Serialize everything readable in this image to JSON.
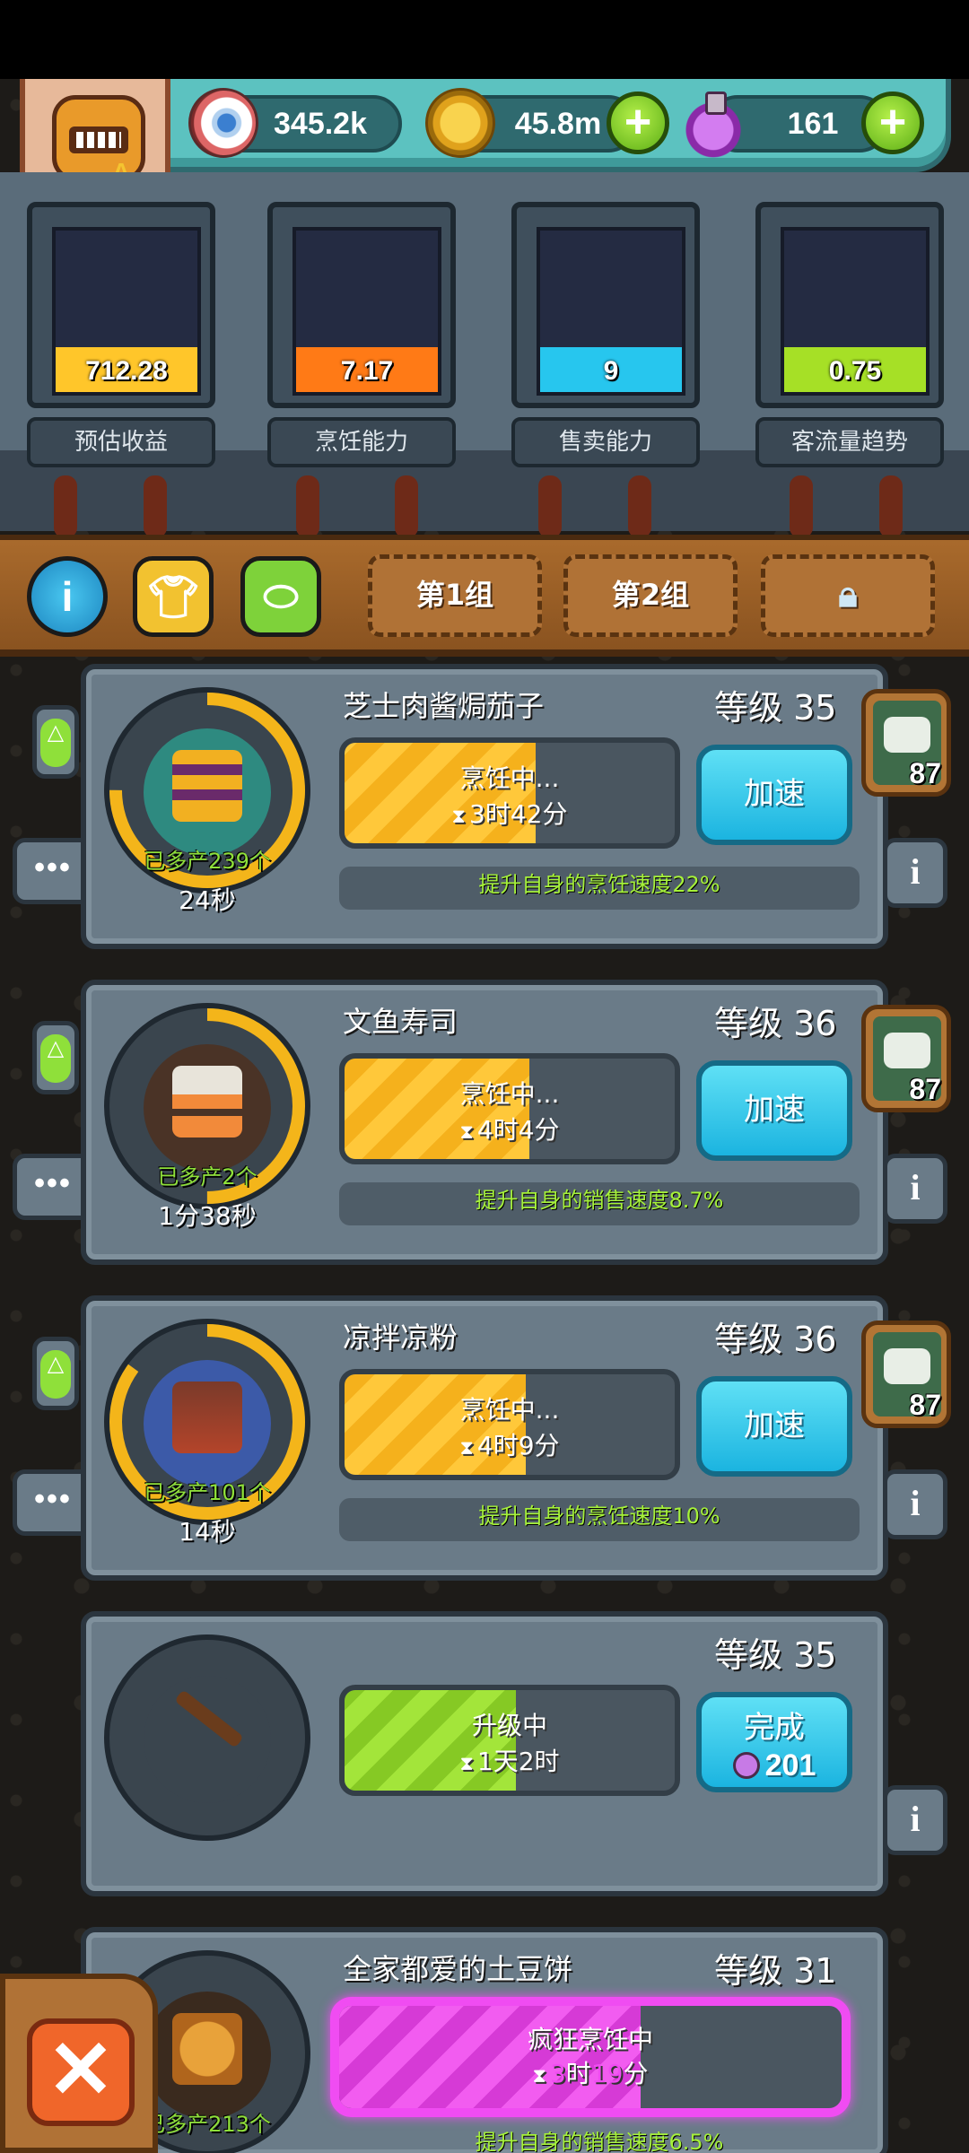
{
  "resources": {
    "eyes": "345.2k",
    "coins": "45.8m",
    "potions": "161"
  },
  "stats": [
    {
      "value": "712.28",
      "label": "预估收益",
      "color": "#ffc62a",
      "fill": 0.28
    },
    {
      "value": "7.17",
      "label": "烹饪能力",
      "color": "#ff7a16",
      "fill": 0.28
    },
    {
      "value": "9",
      "label": "售卖能力",
      "color": "#27c6ee",
      "fill": 0.28
    },
    {
      "value": "0.75",
      "label": "客流量趋势",
      "color": "#a6e026",
      "fill": 0.28
    }
  ],
  "toolbar": {
    "group1": "第1组",
    "group2": "第2组"
  },
  "rows": [
    {
      "name": "芝士肉酱焗茄子",
      "level": "等级 35",
      "extra": "已多产239个",
      "time": "24秒",
      "status": "烹饪中...",
      "remaining": "3时42分",
      "progress": 0.58,
      "button": "加速",
      "bonus": "提升自身的烹饪速度22%",
      "chef_level": "87",
      "ring": 0.75
    },
    {
      "name": "文鱼寿司",
      "level": "等级 36",
      "extra": "已多产2个",
      "time": "1分38秒",
      "status": "烹饪中...",
      "remaining": "4时4分",
      "progress": 0.56,
      "button": "加速",
      "bonus": "提升自身的销售速度8.7%",
      "chef_level": "87",
      "ring": 0.5
    },
    {
      "name": "凉拌凉粉",
      "level": "等级 36",
      "extra": "已多产101个",
      "time": "14秒",
      "status": "烹饪中...",
      "remaining": "4时9分",
      "progress": 0.55,
      "button": "加速",
      "bonus": "提升自身的烹饪速度10%",
      "chef_level": "87",
      "ring": 0.85
    },
    {
      "level": "等级 35",
      "status": "升级中",
      "remaining": "1天2时",
      "progress": 0.52,
      "complete_label": "完成",
      "complete_cost": "201"
    },
    {
      "name": "全家都爱的土豆饼",
      "level": "等级 31",
      "extra": "已多产213个",
      "status": "疯狂烹饪中",
      "remaining_hours": "3",
      "remaining_h_unit": "时",
      "remaining_minutes": "19",
      "remaining_m_unit": "分",
      "progress": 0.6,
      "bonus": "提升自身的销售速度6.5%"
    }
  ],
  "icons": {
    "close": "✕",
    "more": "•••",
    "info": "i",
    "plus": "+",
    "lock": "🔒",
    "hourglass": "⧗"
  }
}
